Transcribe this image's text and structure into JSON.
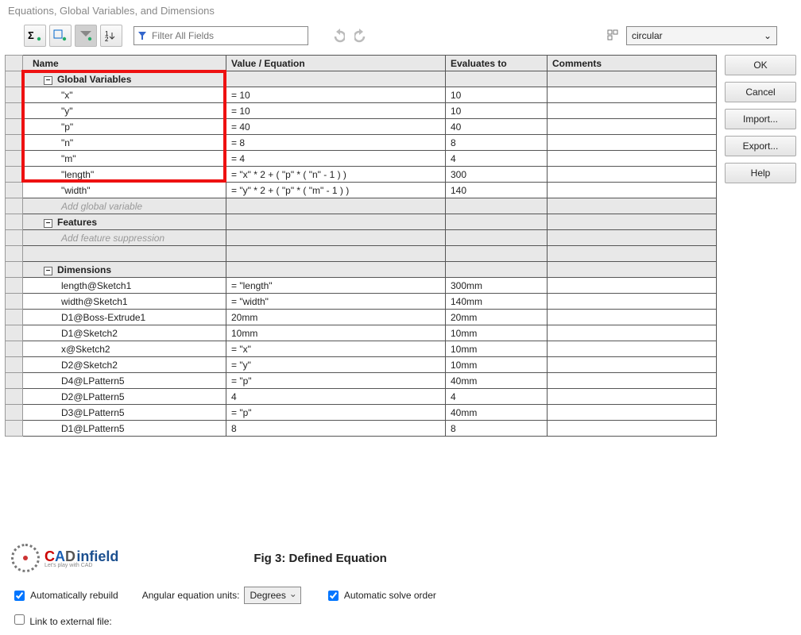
{
  "window_title": "Equations, Global Variables, and Dimensions",
  "filter_placeholder": "Filter All Fields",
  "combo_value": "circular",
  "buttons": {
    "ok": "OK",
    "cancel": "Cancel",
    "import": "Import...",
    "export": "Export...",
    "help": "Help"
  },
  "columns": {
    "name": "Name",
    "value": "Value / Equation",
    "eval": "Evaluates to",
    "comments": "Comments"
  },
  "sections": {
    "global": "Global Variables",
    "features": "Features",
    "dimensions": "Dimensions"
  },
  "placeholders": {
    "add_global": "Add global variable",
    "add_feature": "Add feature suppression"
  },
  "global_rows": [
    {
      "name": "\"x\"",
      "value": "= 10",
      "eval": "10"
    },
    {
      "name": "\"y\"",
      "value": "= 10",
      "eval": "10"
    },
    {
      "name": "\"p\"",
      "value": "= 40",
      "eval": "40"
    },
    {
      "name": "\"n\"",
      "value": "= 8",
      "eval": "8"
    },
    {
      "name": "\"m\"",
      "value": "= 4",
      "eval": "4"
    },
    {
      "name": "\"length\"",
      "value": "= \"x\" * 2 + ( \"p\" * ( \"n\" - 1 ) )",
      "eval": "300"
    },
    {
      "name": "\"width\"",
      "value": "= \"y\" * 2 + ( \"p\" * ( \"m\" - 1 ) )",
      "eval": "140"
    }
  ],
  "dimension_rows": [
    {
      "name": "length@Sketch1",
      "value": "= \"length\"",
      "eval": "300mm"
    },
    {
      "name": "width@Sketch1",
      "value": "= \"width\"",
      "eval": "140mm"
    },
    {
      "name": "D1@Boss-Extrude1",
      "value": "20mm",
      "eval": "20mm"
    },
    {
      "name": "D1@Sketch2",
      "value": "10mm",
      "eval": "10mm"
    },
    {
      "name": "x@Sketch2",
      "value": "= \"x\"",
      "eval": "10mm"
    },
    {
      "name": "D2@Sketch2",
      "value": "= \"y\"",
      "eval": "10mm"
    },
    {
      "name": "D4@LPattern5",
      "value": "= \"p\"",
      "eval": "40mm"
    },
    {
      "name": "D2@LPattern5",
      "value": "4",
      "eval": "4"
    },
    {
      "name": "D3@LPattern5",
      "value": "= \"p\"",
      "eval": "40mm"
    },
    {
      "name": "D1@LPattern5",
      "value": "8",
      "eval": "8"
    }
  ],
  "bottom": {
    "fig_caption": "Fig 3: Defined Equation",
    "auto_rebuild": "Automatically rebuild",
    "angular_label": "Angular equation units:",
    "angular_value": "Degrees",
    "auto_solve": "Automatic solve order",
    "link_external": "Link to external file:"
  },
  "logo": {
    "c": "C",
    "a": "A",
    "d": "D",
    "infield": "infield",
    "tag": "Let's play with CAD"
  }
}
